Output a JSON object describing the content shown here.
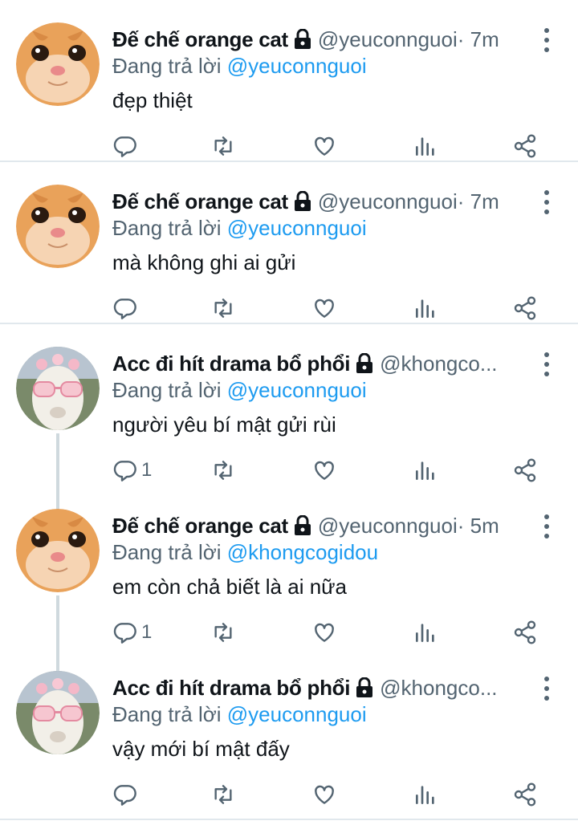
{
  "colors": {
    "name": "#0f1419",
    "muted": "#536471",
    "link": "#1d9bf0",
    "divider": "#e1e8ed",
    "thread_line": "#cfd9de"
  },
  "tweets": [
    {
      "author_name": "Đế chế orange cat",
      "handle": "@yeuconnguoi",
      "time": " · 7m",
      "replying_prefix": "Đang trả lời ",
      "replying_to": "@yeuconnguoi",
      "text": "đẹp thiệt",
      "reply_count": "",
      "avatar": "orange-cat-avatar",
      "protected_icon": "lock-icon"
    },
    {
      "author_name": "Đế chế orange cat",
      "handle": "@yeuconnguoi",
      "time": " · 7m",
      "replying_prefix": "Đang trả lời ",
      "replying_to": "@yeuconnguoi",
      "text": "mà không ghi ai gửi",
      "reply_count": "",
      "avatar": "orange-cat-avatar",
      "protected_icon": "lock-icon"
    },
    {
      "author_name": "Acc đi hít drama bổ phổi",
      "handle": "@khongco...",
      "time": "",
      "replying_prefix": "Đang trả lời ",
      "replying_to": "@yeuconnguoi",
      "text": "người yêu bí mật gửi rùi",
      "reply_count": "1",
      "avatar": "alpaca-avatar",
      "protected_icon": "lock-icon"
    },
    {
      "author_name": "Đế chế orange cat",
      "handle": "@yeuconnguoi",
      "time": " · 5m",
      "replying_prefix": "Đang trả lời ",
      "replying_to": "@khongcogidou",
      "text": "em còn chả biết là ai nữa",
      "reply_count": "1",
      "avatar": "orange-cat-avatar",
      "protected_icon": "lock-icon"
    },
    {
      "author_name": "Acc đi hít drama bổ phổi",
      "handle": "@khongco...",
      "time": "",
      "replying_prefix": "Đang trả lời ",
      "replying_to": "@yeuconnguoi",
      "text": "vậy mới bí mật đấy",
      "reply_count": "",
      "avatar": "alpaca-avatar",
      "protected_icon": "lock-icon"
    }
  ],
  "action_icons": [
    "reply-icon",
    "retweet-icon",
    "like-icon",
    "analytics-icon",
    "share-icon"
  ]
}
